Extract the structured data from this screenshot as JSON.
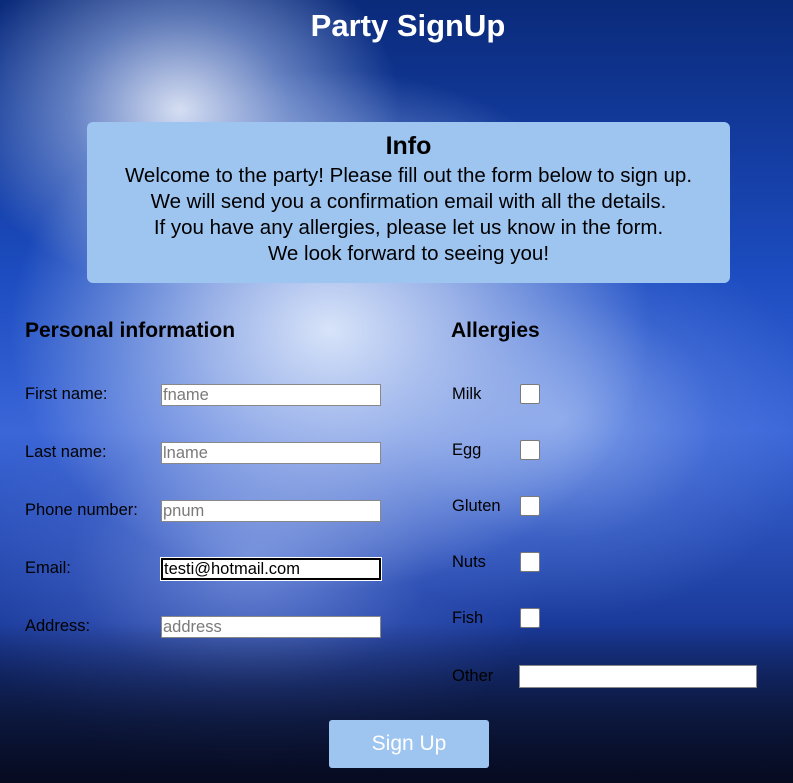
{
  "page": {
    "title": "Party SignUp"
  },
  "info": {
    "title": "Info",
    "lines": [
      "Welcome to the party! Please fill out the form below to sign up.",
      "We will send you a confirmation email with all the details.",
      "If you have any allergies, please let us know in the form.",
      "We look forward to seeing you!"
    ],
    "background_color": "#9ec4f0"
  },
  "personal": {
    "heading": "Personal information",
    "fields": [
      {
        "label": "First name:",
        "placeholder": "fname",
        "value": ""
      },
      {
        "label": "Last name:",
        "placeholder": "lname",
        "value": ""
      },
      {
        "label": "Phone number:",
        "placeholder": "pnum",
        "value": ""
      },
      {
        "label": "Email:",
        "placeholder": "",
        "value": "testi@hotmail.com"
      },
      {
        "label": "Address:",
        "placeholder": "address",
        "value": ""
      }
    ]
  },
  "allergies": {
    "heading": "Allergies",
    "items": [
      {
        "label": "Milk",
        "checked": false
      },
      {
        "label": "Egg",
        "checked": false
      },
      {
        "label": "Gluten",
        "checked": false
      },
      {
        "label": "Nuts",
        "checked": false
      },
      {
        "label": "Fish",
        "checked": false
      }
    ],
    "other_label": "Other",
    "other_value": ""
  },
  "submit": {
    "label": "Sign Up",
    "color": "#9ec4f0"
  }
}
